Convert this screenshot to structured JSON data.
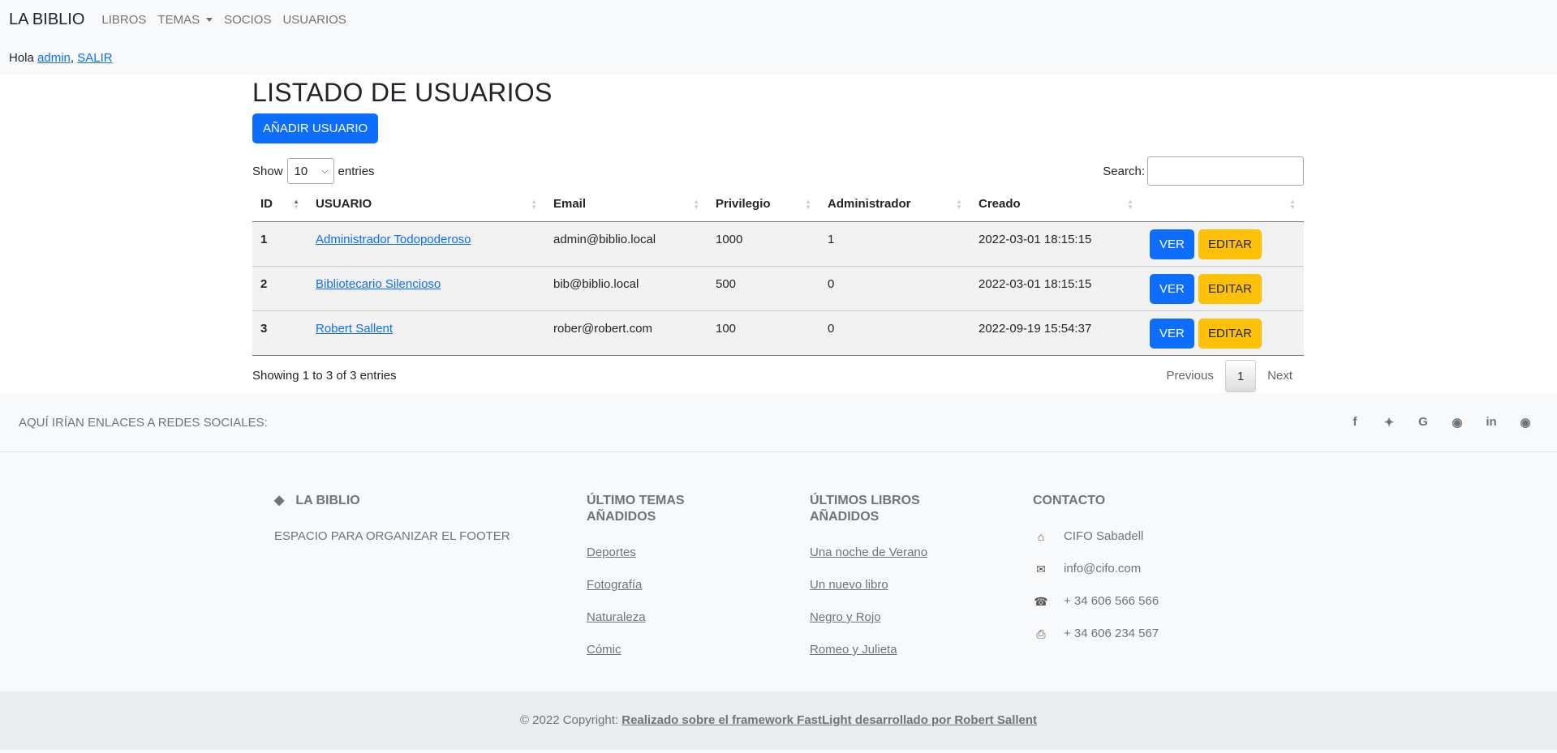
{
  "navbar": {
    "brand": "LA BIBLIO",
    "links": [
      "LIBROS",
      "TEMAS",
      "SOCIOS",
      "USUARIOS"
    ],
    "greeting_prefix": "Hola",
    "user": "admin",
    "separator": ",",
    "logout": "SALIR"
  },
  "main": {
    "title": "LISTADO DE USUARIOS",
    "add_button": "AÑADIR USUARIO",
    "show_label": "Show",
    "entries_label": "entries",
    "page_size": "10",
    "search_label": "Search:",
    "search_value": "",
    "columns": [
      "ID",
      "USUARIO",
      "Email",
      "Privilegio",
      "Administrador",
      "Creado",
      ""
    ],
    "rows": [
      {
        "id": "1",
        "usuario": "Administrador Todopoderoso",
        "email": "admin@biblio.local",
        "privilegio": "1000",
        "admin": "1",
        "creado": "2022-03-01 18:15:15"
      },
      {
        "id": "2",
        "usuario": "Bibliotecario Silencioso",
        "email": "bib@biblio.local",
        "privilegio": "500",
        "admin": "0",
        "creado": "2022-03-01 18:15:15"
      },
      {
        "id": "3",
        "usuario": "Robert Sallent",
        "email": "rober@robert.com",
        "privilegio": "100",
        "admin": "0",
        "creado": "2022-09-19 15:54:37"
      }
    ],
    "view_label": "VER",
    "edit_label": "EDITAR",
    "info": "Showing 1 to 3 of 3 entries",
    "prev": "Previous",
    "page": "1",
    "next": "Next"
  },
  "footer": {
    "social_text": "AQUÍ IRÍAN ENLACES A REDES SOCIALES:",
    "social_icons": [
      "facebook-icon",
      "twitter-icon",
      "google-icon",
      "instagram-icon",
      "linkedin-icon",
      "github-icon"
    ],
    "brand": "LA BIBLIO",
    "brand_text": "ESPACIO PARA ORGANIZAR EL FOOTER",
    "topics_title": "ÚLTIMO TEMAS AÑADIDOS",
    "topics": [
      "Deportes",
      "Fotografía",
      "Naturaleza",
      "Cómic"
    ],
    "books_title": "ÚLTIMOS LIBROS AÑADIDOS",
    "books": [
      "Una noche de Verano",
      "Un nuevo libro",
      "Negro y Rojo",
      "Romeo y Julieta"
    ],
    "contact_title": "CONTACTO",
    "contact": [
      {
        "icon": "home-icon",
        "text": "CIFO Sabadell"
      },
      {
        "icon": "envelope-icon",
        "text": "info@cifo.com"
      },
      {
        "icon": "phone-icon",
        "text": "+ 34 606 566 566"
      },
      {
        "icon": "printer-icon",
        "text": "+ 34 606 234 567"
      }
    ],
    "copyright_prefix": "© 2022 Copyright:",
    "copyright_link": "Realizado sobre el framework FastLight desarrollado por Robert Sallent"
  },
  "colors": {
    "primary": "#0d6efd",
    "warning": "#ffc107",
    "footer_bg": "#f8f9fa"
  }
}
